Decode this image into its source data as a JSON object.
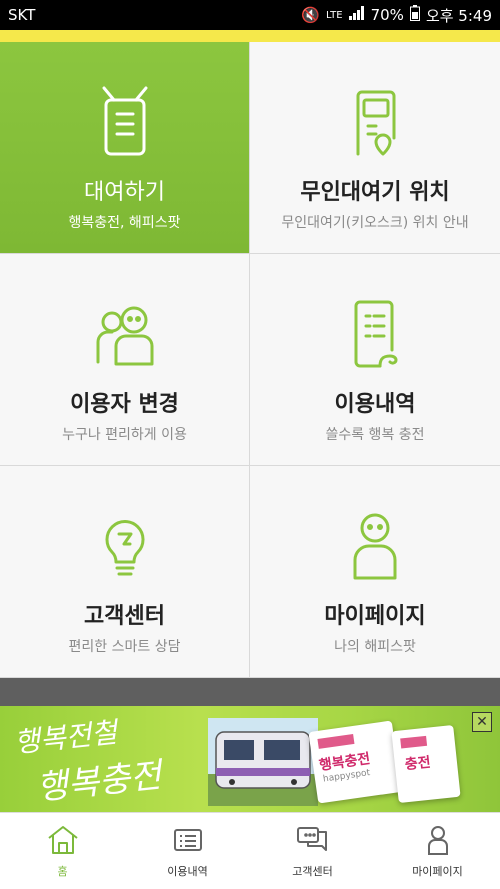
{
  "status": {
    "carrier": "SKT",
    "network": "LTE",
    "battery": "70%",
    "time": "오후 5:49"
  },
  "tiles": [
    {
      "title": "대여하기",
      "subtitle": "행복충전, 해피스팟",
      "icon": "rental-device-icon",
      "active": true
    },
    {
      "title": "무인대여기 위치",
      "subtitle": "무인대여기(키오스크) 위치 안내",
      "icon": "kiosk-location-icon"
    },
    {
      "title": "이용자 변경",
      "subtitle": "누구나 편리하게 이용",
      "icon": "users-icon"
    },
    {
      "title": "이용내역",
      "subtitle": "쓸수록 행복 충전",
      "icon": "history-doc-icon"
    },
    {
      "title": "고객센터",
      "subtitle": "편리한 스마트 상담",
      "icon": "lightbulb-icon"
    },
    {
      "title": "마이페이지",
      "subtitle": "나의 해피스팟",
      "icon": "person-icon"
    }
  ],
  "banner": {
    "line1": "행복전철",
    "line2": "행복충전",
    "card_label_1": "행복충전",
    "card_label_2": "충전",
    "card_sub": "happyspot"
  },
  "tabs": [
    {
      "label": "홈",
      "icon": "home-icon",
      "active": true
    },
    {
      "label": "이용내역",
      "icon": "list-icon"
    },
    {
      "label": "고객센터",
      "icon": "chat-icon"
    },
    {
      "label": "마이페이지",
      "icon": "person-icon"
    }
  ],
  "colors": {
    "accent": "#8cc63f",
    "tile_bg": "#f7f7f7"
  }
}
